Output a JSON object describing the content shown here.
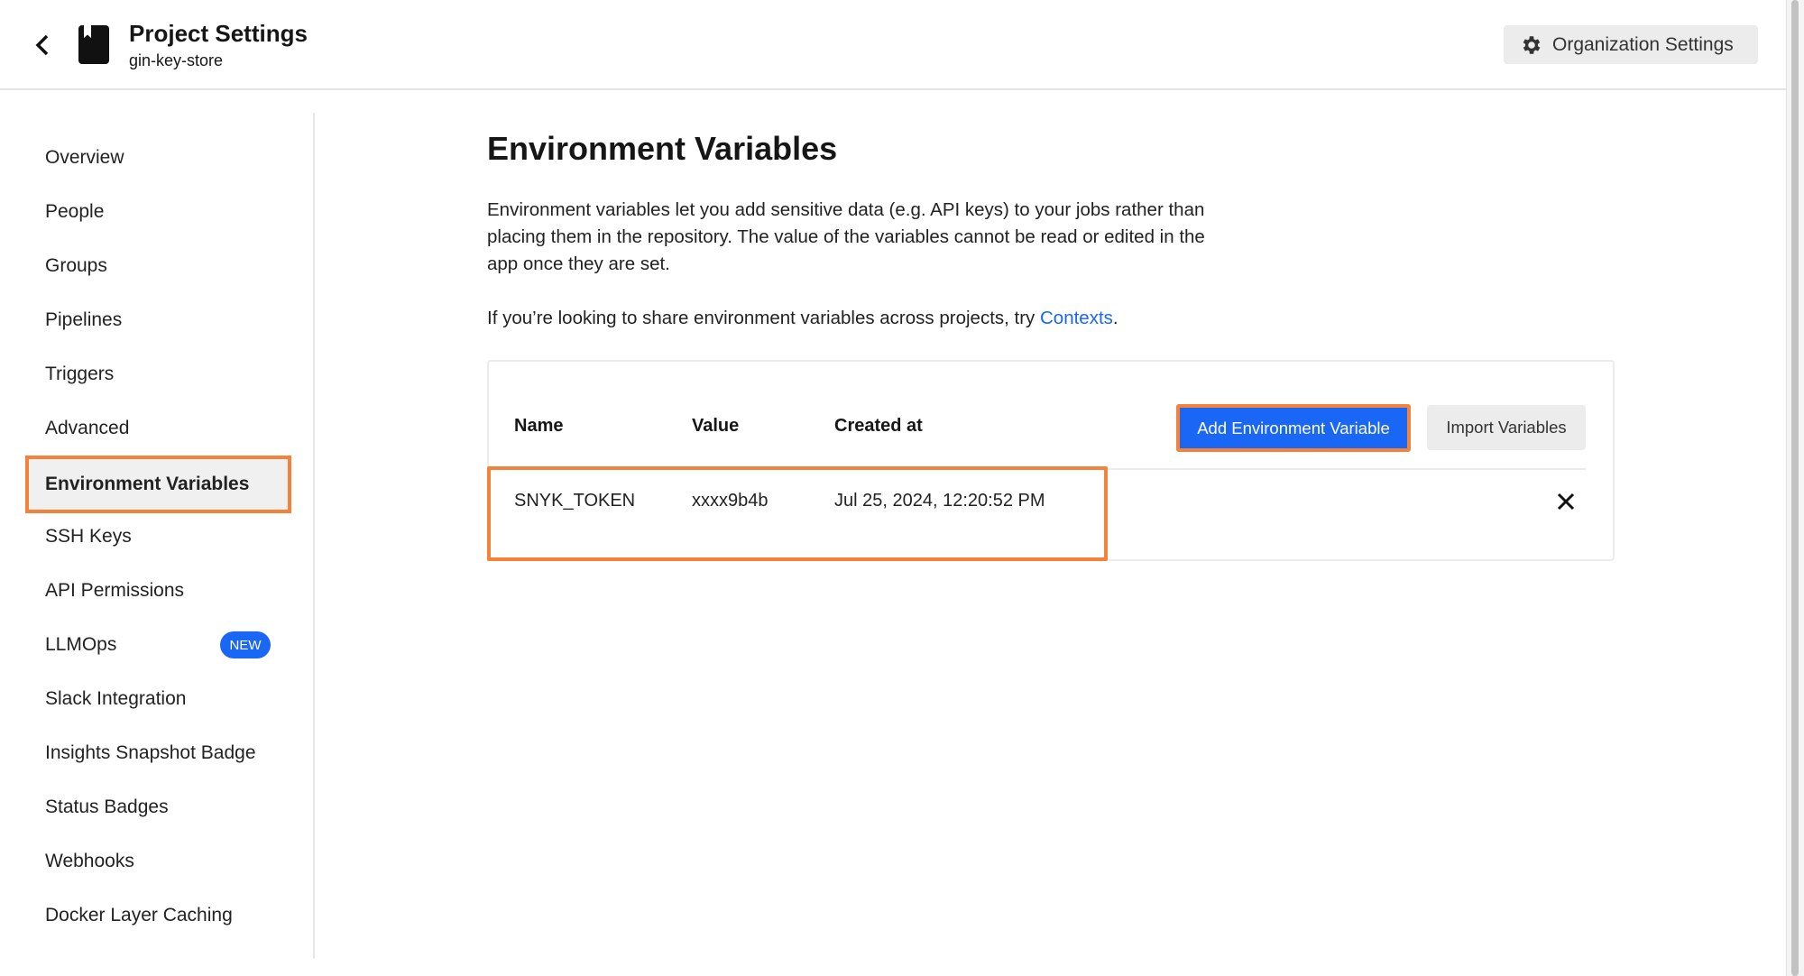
{
  "header": {
    "title": "Project Settings",
    "subtitle": "gin-key-store",
    "org_settings_label": "Organization Settings"
  },
  "sidebar": {
    "items": [
      {
        "label": "Overview"
      },
      {
        "label": "People"
      },
      {
        "label": "Groups"
      },
      {
        "label": "Pipelines"
      },
      {
        "label": "Triggers"
      },
      {
        "label": "Advanced"
      },
      {
        "label": "Environment Variables",
        "active": true
      },
      {
        "label": "SSH Keys"
      },
      {
        "label": "API Permissions"
      },
      {
        "label": "LLMOps",
        "badge": "NEW"
      },
      {
        "label": "Slack Integration"
      },
      {
        "label": "Insights Snapshot Badge"
      },
      {
        "label": "Status Badges"
      },
      {
        "label": "Webhooks"
      },
      {
        "label": "Docker Layer Caching"
      }
    ]
  },
  "main": {
    "title": "Environment Variables",
    "description": "Environment variables let you add sensitive data (e.g. API keys) to your jobs rather than placing them in the repository. The value of the variables cannot be read or edited in the app once they are set.",
    "contexts_prefix": "If you’re looking to share environment variables across projects, try ",
    "contexts_link": "Contexts",
    "contexts_suffix": ".",
    "table": {
      "columns": [
        "Name",
        "Value",
        "Created at"
      ],
      "add_button": "Add Environment Variable",
      "import_button": "Import Variables",
      "rows": [
        {
          "name": "SNYK_TOKEN",
          "value": "xxxx9b4b",
          "created_at": "Jul 25, 2024, 12:20:52 PM"
        }
      ]
    }
  },
  "colors": {
    "accent": "#1a66f5",
    "highlight": "#f5823b"
  }
}
